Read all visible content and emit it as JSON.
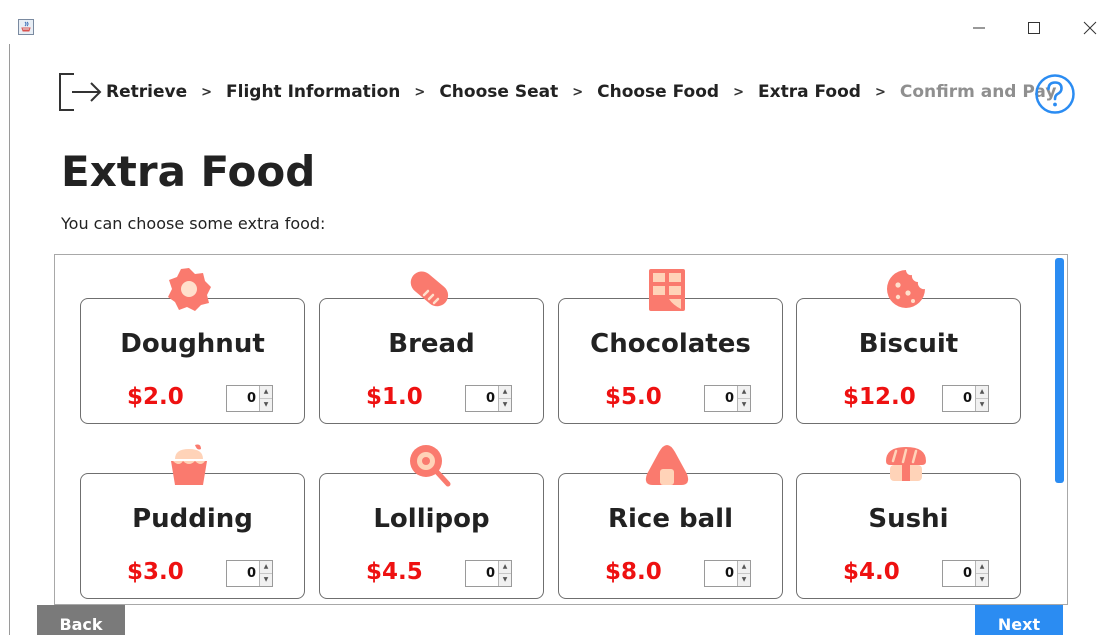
{
  "window": {
    "minimize": "–",
    "maximize": "☐",
    "close": "✕"
  },
  "breadcrumb": {
    "separator": ">",
    "steps": [
      "Retrieve",
      "Flight Information",
      "Choose Seat",
      "Choose Food",
      "Extra Food",
      "Confirm and Pay"
    ],
    "current_index": 5
  },
  "page": {
    "title": "Extra Food",
    "subtitle": "You can choose some extra food:"
  },
  "foods": [
    {
      "name": "Doughnut",
      "price": "$2.0",
      "quantity": "0",
      "icon": "doughnut-icon"
    },
    {
      "name": "Bread",
      "price": "$1.0",
      "quantity": "0",
      "icon": "bread-icon"
    },
    {
      "name": "Chocolates",
      "price": "$5.0",
      "quantity": "0",
      "icon": "chocolate-icon"
    },
    {
      "name": "Biscuit",
      "price": "$12.0",
      "quantity": "0",
      "icon": "biscuit-icon"
    },
    {
      "name": "Pudding",
      "price": "$3.0",
      "quantity": "0",
      "icon": "pudding-icon"
    },
    {
      "name": "Lollipop",
      "price": "$4.5",
      "quantity": "0",
      "icon": "lollipop-icon"
    },
    {
      "name": "Rice ball",
      "price": "$8.0",
      "quantity": "0",
      "icon": "rice-ball-icon"
    },
    {
      "name": "Sushi",
      "price": "$4.0",
      "quantity": "0",
      "icon": "sushi-icon"
    }
  ],
  "buttons": {
    "back": "Back",
    "next": "Next"
  },
  "colors": {
    "accent": "#2b8cf2",
    "price": "#ee1111",
    "icon": "#fa7a6e",
    "icon_light": "#ffd3b8",
    "current_step": "#8f8f8f"
  }
}
